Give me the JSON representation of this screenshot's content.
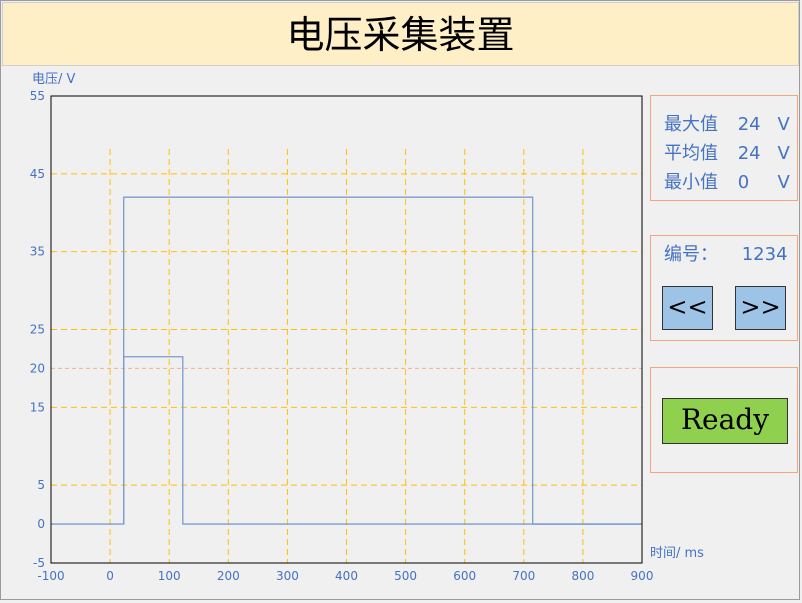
{
  "header": {
    "title": "电压采集装置"
  },
  "chart": {
    "ylabel": "电压/ V",
    "xlabel": "时间/ ms"
  },
  "stats": {
    "max_label": "最大值",
    "max_value": "24",
    "avg_label": "平均值",
    "avg_value": "24",
    "min_label": "最小值",
    "min_value": "0",
    "unit": "V"
  },
  "record": {
    "id_label": "编号：",
    "id_value": "1234",
    "prev_label": "<<",
    "next_label": ">>"
  },
  "status": {
    "ready_label": "Ready"
  },
  "chart_data": {
    "type": "line",
    "xlim": [
      -100,
      900
    ],
    "ylim": [
      -5,
      55
    ],
    "x_ticks": [
      -100,
      0,
      100,
      200,
      300,
      400,
      500,
      600,
      700,
      800,
      900
    ],
    "y_ticks": [
      -5,
      0,
      5,
      15,
      20,
      25,
      35,
      45,
      55
    ],
    "grid_x": [
      0,
      100,
      200,
      300,
      400,
      500,
      600,
      700,
      800,
      900
    ],
    "grid_y": [
      5,
      15,
      25,
      35,
      45
    ],
    "reference_line_y": 20,
    "grid": true,
    "series": [
      {
        "points": [
          [
            -100,
            0
          ],
          [
            23,
            0
          ],
          [
            23,
            42
          ],
          [
            715,
            42
          ],
          [
            715,
            0
          ],
          [
            900,
            0
          ]
        ]
      },
      {
        "points": [
          [
            23,
            0
          ],
          [
            23,
            21.5
          ],
          [
            123,
            21.5
          ],
          [
            123,
            0
          ],
          [
            900,
            0
          ]
        ]
      }
    ],
    "colors": {
      "series": "#7a9ccf",
      "grid": "#ffc000",
      "reference": "#f4b183",
      "ticks": "#4472c4",
      "frame": "#000000"
    }
  }
}
